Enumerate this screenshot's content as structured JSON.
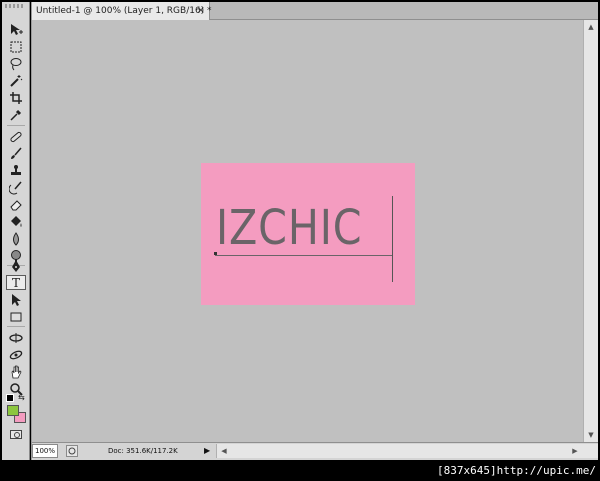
{
  "document": {
    "tab_title": "Untitled-1 @ 100% (Layer 1, RGB/16) *",
    "close_glyph": "×"
  },
  "canvas": {
    "background_color": "#f49cc0",
    "text": "IZCHIC",
    "text_color": "#6a6468"
  },
  "tools": [
    {
      "name": "move-tool",
      "icon": "move-icon"
    },
    {
      "name": "marquee-tool",
      "icon": "marquee-icon"
    },
    {
      "name": "lasso-tool",
      "icon": "lasso-icon"
    },
    {
      "name": "magic-wand-tool",
      "icon": "magic-wand-icon"
    },
    {
      "name": "crop-tool",
      "icon": "crop-icon"
    },
    {
      "name": "eyedropper-tool",
      "icon": "eyedropper-icon"
    },
    {
      "name": "healing-brush-tool",
      "icon": "bandage-icon"
    },
    {
      "name": "brush-tool",
      "icon": "brush-icon"
    },
    {
      "name": "clone-stamp-tool",
      "icon": "stamp-icon"
    },
    {
      "name": "history-brush-tool",
      "icon": "history-brush-icon"
    },
    {
      "name": "eraser-tool",
      "icon": "eraser-icon"
    },
    {
      "name": "paint-bucket-tool",
      "icon": "bucket-icon"
    },
    {
      "name": "blur-tool",
      "icon": "drop-icon"
    },
    {
      "name": "dodge-tool",
      "icon": "dodge-icon"
    },
    {
      "name": "pen-tool",
      "icon": "pen-icon"
    },
    {
      "name": "type-tool",
      "icon": "type-icon",
      "glyph": "T",
      "active": true
    },
    {
      "name": "path-selection-tool",
      "icon": "arrow-icon"
    },
    {
      "name": "shape-tool",
      "icon": "rectangle-icon"
    },
    {
      "name": "3d-rotate-tool",
      "icon": "rotate-3d-icon"
    },
    {
      "name": "3d-orbit-tool",
      "icon": "orbit-3d-icon"
    },
    {
      "name": "hand-tool",
      "icon": "hand-icon"
    },
    {
      "name": "zoom-tool",
      "icon": "magnifier-icon"
    }
  ],
  "colors": {
    "foreground": "#8cc63f",
    "background": "#f49cc0"
  },
  "status": {
    "zoom": "100%",
    "doc_info": "Doc: 351.6K/117.2K",
    "menu_arrow": "▶"
  },
  "watermark": {
    "text": "[837x645]http://upic.me/"
  }
}
